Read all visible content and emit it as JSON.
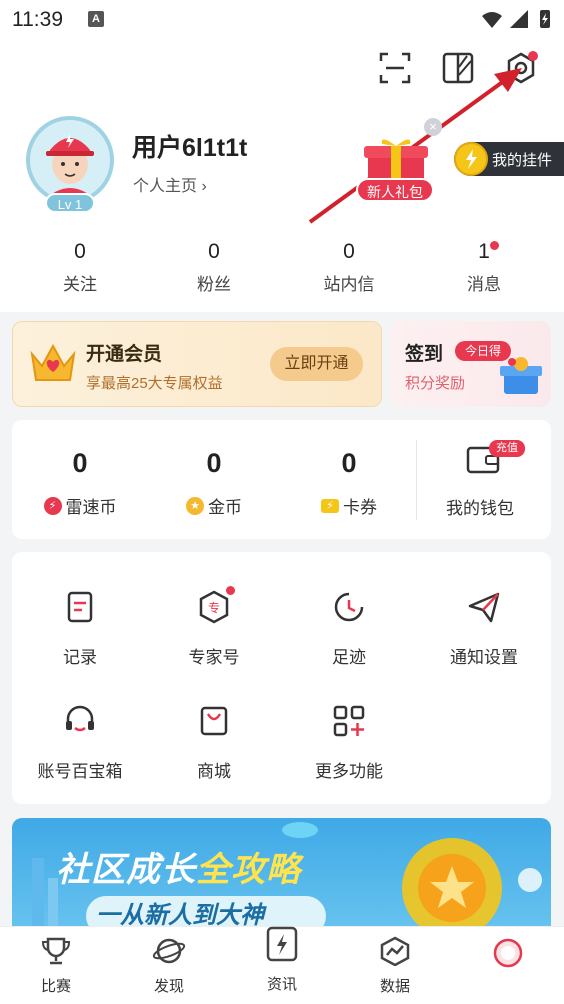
{
  "status_bar": {
    "time": "11:39",
    "app_icon_letter": "A"
  },
  "toolbar": {
    "icons": [
      "scan-icon",
      "theme-icon",
      "settings-icon"
    ]
  },
  "profile": {
    "username": "用户6l1t1t",
    "homepage_link": "个人主页 ›",
    "level": "Lv 1",
    "gift_label": "新人礼包",
    "pendant_label": "我的挂件"
  },
  "stats": [
    {
      "value": "0",
      "label": "关注"
    },
    {
      "value": "0",
      "label": "粉丝"
    },
    {
      "value": "0",
      "label": "站内信"
    },
    {
      "value": "1",
      "label": "消息"
    }
  ],
  "vip": {
    "title": "开通会员",
    "subtitle": "享最高25大专属权益",
    "button": "立即开通"
  },
  "signin": {
    "title": "签到",
    "tag": "今日得",
    "subtitle": "积分奖励"
  },
  "wallet": {
    "coins": [
      {
        "value": "0",
        "label": "雷速币",
        "icon": "lightning-coin-icon",
        "color": "#e8384f"
      },
      {
        "value": "0",
        "label": "金币",
        "icon": "gold-coin-icon",
        "color": "#f5b82e"
      },
      {
        "value": "0",
        "label": "卡券",
        "icon": "coupon-icon",
        "color": "#f5c518"
      }
    ],
    "wallet_label": "我的钱包",
    "charge_tag": "充值"
  },
  "features": [
    {
      "label": "记录",
      "icon": "record-icon"
    },
    {
      "label": "专家号",
      "icon": "expert-icon"
    },
    {
      "label": "足迹",
      "icon": "footprint-icon"
    },
    {
      "label": "通知设置",
      "icon": "notification-icon"
    },
    {
      "label": "账号百宝箱",
      "icon": "headset-icon"
    },
    {
      "label": "商城",
      "icon": "shop-icon"
    },
    {
      "label": "更多功能",
      "icon": "more-functions-icon"
    }
  ],
  "banner": {
    "title_part1": "社区成长",
    "title_part2": "全攻略",
    "subtitle": "一从新人到大神"
  },
  "tabbar": [
    {
      "label": "比赛",
      "icon": "trophy-icon"
    },
    {
      "label": "发现",
      "icon": "planet-icon"
    },
    {
      "label": "资讯",
      "icon": "news-icon"
    },
    {
      "label": "数据",
      "icon": "data-icon"
    },
    {
      "label": "",
      "icon": "profile-tab-icon"
    }
  ],
  "colors": {
    "accent_red": "#e8384f",
    "gold": "#f4cb8c",
    "banner_blue": "#3fa9e6"
  }
}
